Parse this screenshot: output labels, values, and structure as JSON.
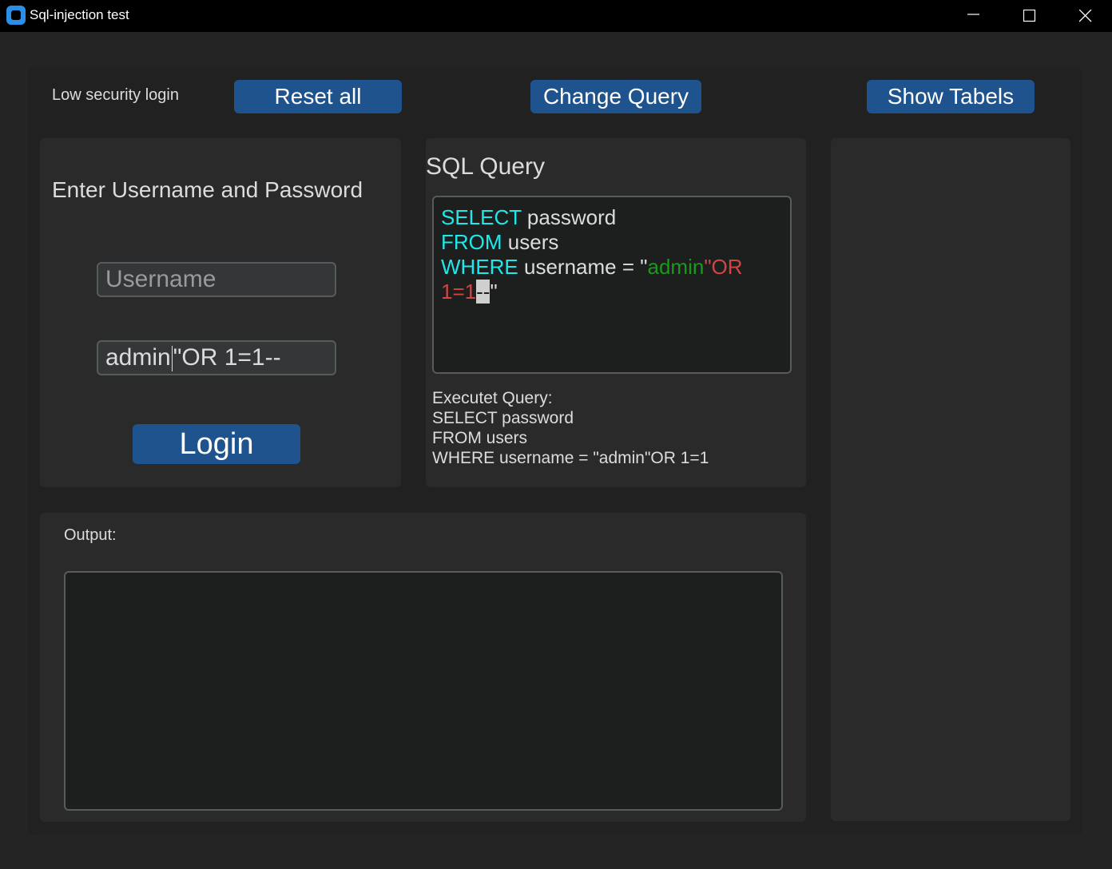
{
  "window": {
    "title": "Sql-injection test"
  },
  "toolbar": {
    "mode_label": "Low security login",
    "reset_label": "Reset all",
    "change_query_label": "Change Query",
    "show_tables_label": "Show Tabels"
  },
  "login": {
    "heading": "Enter Username and Password",
    "username_placeholder": "Username",
    "password_value_before_caret": "admin",
    "password_value_after_caret": "\"OR 1=1--",
    "login_label": "Login"
  },
  "query": {
    "heading": "SQL Query",
    "line1_kw": "SELECT",
    "line1_rest": " password",
    "line2_kw": "FROM",
    "line2_rest": " users",
    "line3_kw": "WHERE",
    "line3_rest": " username = \"",
    "line3_value": "admin",
    "line3_injected": "\"OR",
    "line4_injected": "1=1",
    "line4_selected": "--",
    "line4_end": "\""
  },
  "executed": {
    "label": "Executet Query:",
    "line1": "SELECT password",
    "line2": "FROM users",
    "line3": "WHERE username = \"admin\"OR 1=1"
  },
  "output": {
    "label": "Output:"
  },
  "colors": {
    "button": "#1f538d",
    "keyword": "#1ee8e8",
    "value": "#1a9a1a",
    "injection": "#d04646"
  }
}
